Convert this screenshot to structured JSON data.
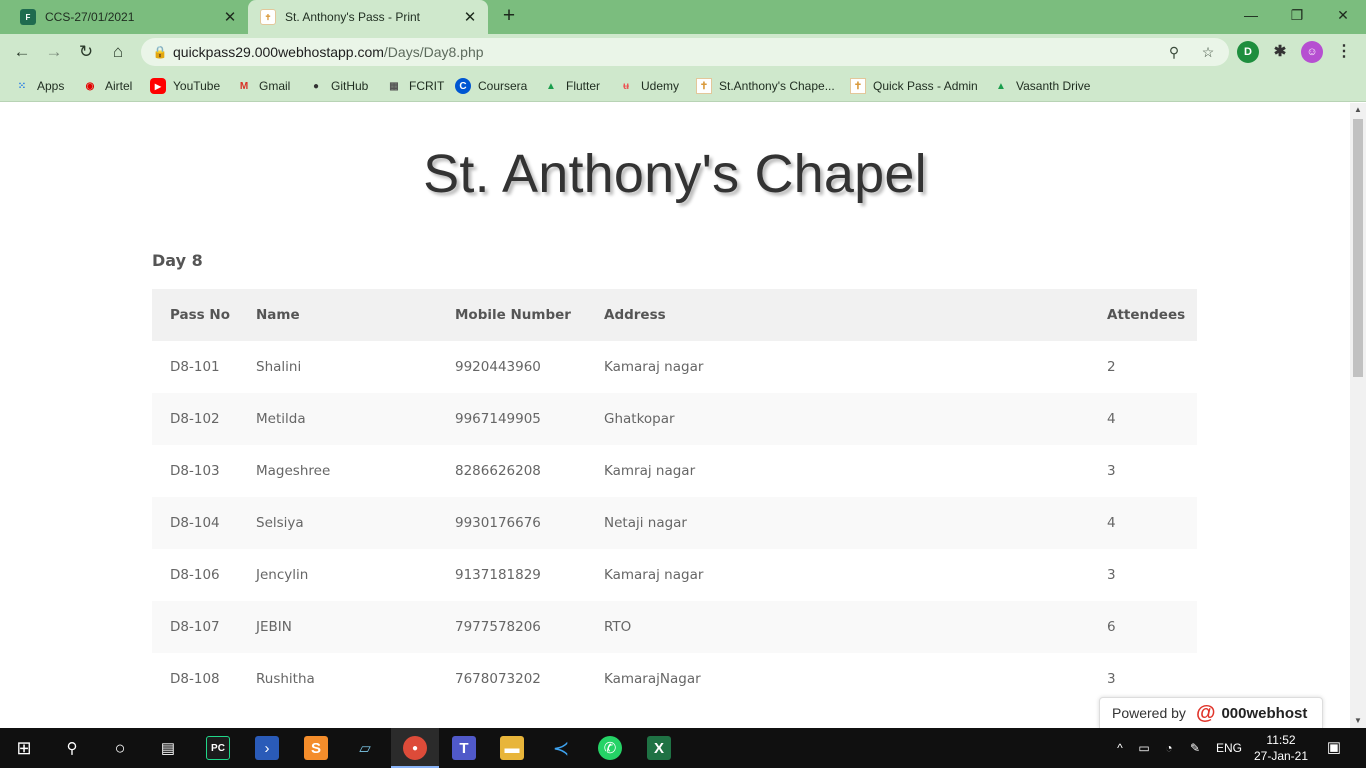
{
  "browser": {
    "tabs": [
      {
        "title": "CCS-27/01/2021",
        "icon": "forms-icon"
      },
      {
        "title": "St. Anthony's Pass - Print",
        "icon": "chapel-icon"
      }
    ],
    "url_host": "quickpass29.000webhostapp.com",
    "url_path": "/Days/Day8.php",
    "bookmarks": [
      {
        "label": "Apps",
        "icon": "apps-grid-icon"
      },
      {
        "label": "Airtel",
        "icon": "airtel-icon"
      },
      {
        "label": "YouTube",
        "icon": "youtube-icon"
      },
      {
        "label": "Gmail",
        "icon": "gmail-icon"
      },
      {
        "label": "GitHub",
        "icon": "github-icon"
      },
      {
        "label": "FCRIT",
        "icon": "fcrit-icon"
      },
      {
        "label": "Coursera",
        "icon": "coursera-icon"
      },
      {
        "label": "Flutter",
        "icon": "drive-icon"
      },
      {
        "label": "Udemy",
        "icon": "udemy-icon"
      },
      {
        "label": "St.Anthony's Chape...",
        "icon": "chapel-icon"
      },
      {
        "label": "Quick Pass - Admin",
        "icon": "chapel-icon"
      },
      {
        "label": "Vasanth Drive",
        "icon": "drive-icon"
      }
    ]
  },
  "page": {
    "title": "St. Anthony's Chapel",
    "day": "Day 8",
    "columns": [
      "Pass No",
      "Name",
      "Mobile Number",
      "Address",
      "Attendees"
    ],
    "rows": [
      [
        "D8-101",
        "Shalini",
        "9920443960",
        "Kamaraj nagar",
        "2"
      ],
      [
        "D8-102",
        "Metilda",
        "9967149905",
        "Ghatkopar",
        "4"
      ],
      [
        "D8-103",
        "Mageshree",
        "8286626208",
        "Kamraj nagar",
        "3"
      ],
      [
        "D8-104",
        "Selsiya",
        "9930176676",
        "Netaji nagar",
        "4"
      ],
      [
        "D8-106",
        "Jencylin",
        "9137181829",
        "Kamaraj nagar",
        "3"
      ],
      [
        "D8-107",
        "JEBIN",
        "7977578206",
        "RTO",
        "6"
      ],
      [
        "D8-108",
        "Rushitha",
        "7678073202",
        "KamarajNagar",
        "3"
      ]
    ],
    "powered_by": "Powered by",
    "powered_brand": "000webhost"
  },
  "taskbar": {
    "lang": "ENG",
    "time": "11:52",
    "date": "27-Jan-21"
  },
  "colors": {
    "chrome_tabstrip": "#7bbd7e",
    "chrome_toolbar": "#cfe8cc",
    "table_header": "#f1f1f1",
    "row_alt": "#f9f9f9"
  }
}
